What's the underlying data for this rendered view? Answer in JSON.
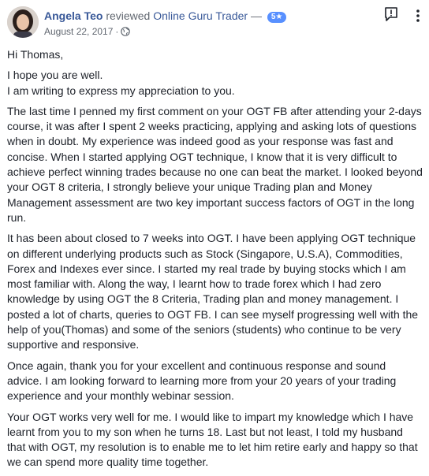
{
  "header": {
    "author": "Angela Teo",
    "verb": "reviewed",
    "page_name": "Online Guru Trader",
    "dash": "—",
    "rating": "5★",
    "date": "August 22, 2017",
    "separator": "·",
    "icons": {
      "privacy": "globe-icon",
      "report": "report-icon",
      "more": "more-icon"
    }
  },
  "post": {
    "greeting": "Hi Thomas,",
    "line1": "I hope you are well.",
    "line2": "I am writing to express my appreciation to you.",
    "para1": "The last time I penned my first comment on your OGT FB after attending your 2-days course, it was after I spent 2 weeks practicing, applying and asking lots of questions when in doubt. My experience was indeed good as your response was fast and concise. When I started applying OGT technique, I know that it is very difficult to achieve perfect winning trades because no one can beat the market. I looked beyond your OGT 8 criteria, I strongly believe your unique Trading plan and Money Management assessment are two key important success factors of OGT in the long run.",
    "para2": "It has been about closed to 7 weeks into OGT. I have been applying OGT technique on different underlying products such as Stock (Singapore, U.S.A), Commodities, Forex and Indexes ever since. I started my real trade by buying stocks which I am most familiar with. Along the way, I learnt how to trade forex which I had zero knowledge by using OGT the 8 Criteria, Trading plan and money management. I posted a lot of charts, queries to OGT FB. I can see myself progressing well with the help of you(Thomas) and some of the seniors (students) who continue to be very supportive and responsive.",
    "para3": "Once again, thank you for your excellent and continuous response and sound advice. I am looking forward to learning more from your 20 years of your trading experience and your monthly webinar session.",
    "para4": "Your OGT works very well for me. I would like to impart my knowledge which I have learnt from you to my son when he turns 18. Last but not least, I told my husband that with OGT, my resolution is to enable me to let him retire early and happy so that we can spend more quality time together."
  }
}
